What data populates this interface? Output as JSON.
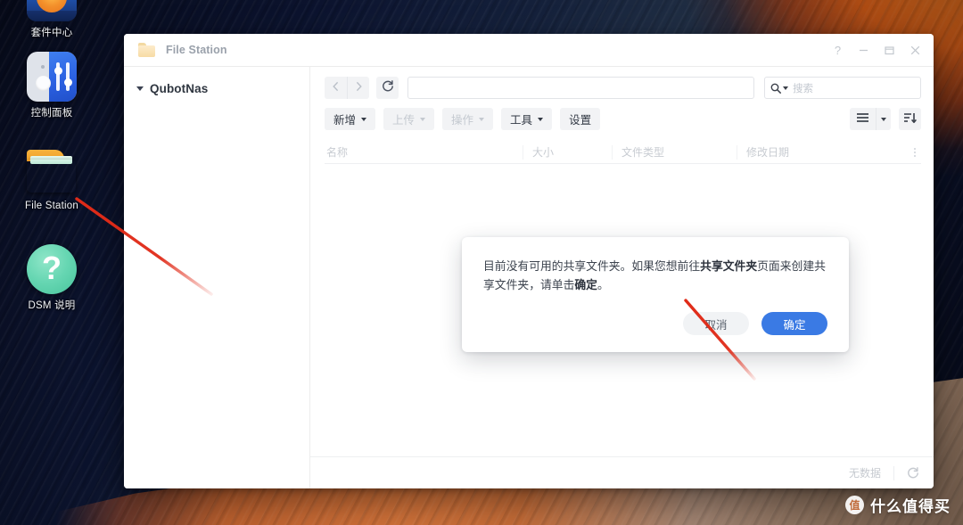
{
  "desktop": {
    "icons": [
      {
        "label": "套件中心",
        "icon": "package-center-icon"
      },
      {
        "label": "控制面板",
        "icon": "control-panel-icon"
      },
      {
        "label": "File Station",
        "icon": "file-station-folder-icon"
      },
      {
        "label": "DSM 说明",
        "icon": "help-question-icon"
      }
    ]
  },
  "window": {
    "title": "File Station",
    "controls": {
      "help": "?",
      "minimize": "−",
      "maximize": "□",
      "close": "×"
    }
  },
  "sidebar": {
    "root_label": "QubotNas"
  },
  "nav": {
    "back": "‹",
    "forward": "›",
    "reload": "reload-icon",
    "path_value": "",
    "path_placeholder": ""
  },
  "search": {
    "placeholder": "搜索",
    "value": ""
  },
  "toolbar": {
    "buttons": [
      {
        "label": "新增",
        "caret": true,
        "disabled": false
      },
      {
        "label": "上传",
        "caret": true,
        "disabled": true
      },
      {
        "label": "操作",
        "caret": true,
        "disabled": true
      },
      {
        "label": "工具",
        "caret": true,
        "disabled": false
      },
      {
        "label": "设置",
        "caret": false,
        "disabled": false
      }
    ],
    "view_list": "list-view-icon",
    "view_caret": "chevron-down-icon",
    "sort": "sort-descending-icon"
  },
  "columns": {
    "name": "名称",
    "size": "大小",
    "type": "文件类型",
    "date": "修改日期",
    "menu": "column-options-icon"
  },
  "status": {
    "text": "无数据",
    "refresh": "refresh-icon"
  },
  "dialog": {
    "text_part1": "目前没有可用的共享文件夹。如果您想前往",
    "text_bold1": "共享文件夹",
    "text_part2": "页面来创建共享文",
    "text_part3": "件夹，请单击",
    "text_bold2": "确定",
    "text_part4": "。",
    "cancel_label": "取消",
    "confirm_label": "确定"
  },
  "watermark": {
    "badge": "值",
    "text": "什么值得买"
  },
  "colors": {
    "accent_blue": "#3a7ae4",
    "folder_orange": "#f0a52c",
    "help_teal": "#66d6b2",
    "annotation_red": "#e02b18",
    "window_bg": "#ffffff"
  }
}
